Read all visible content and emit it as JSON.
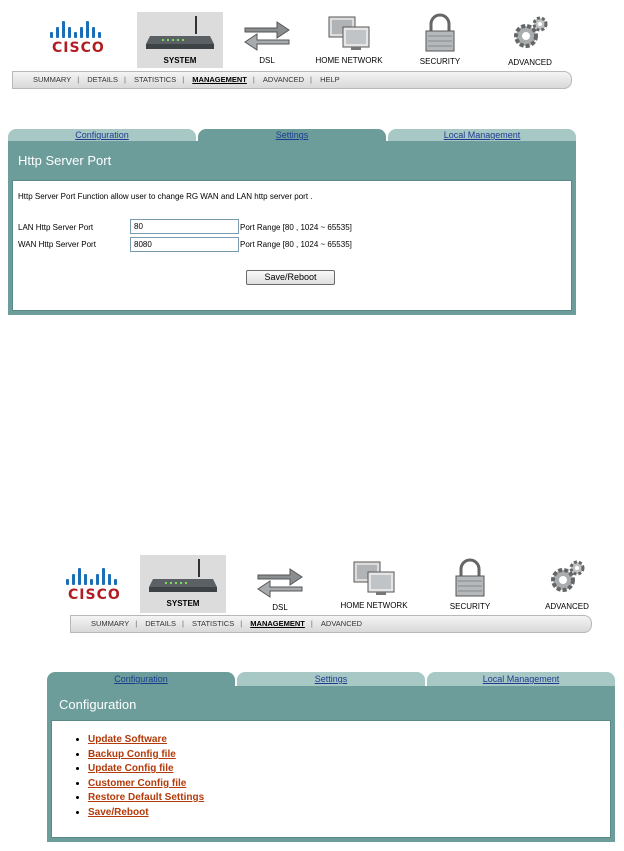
{
  "brand": {
    "logo_text": "CISCO"
  },
  "screen1": {
    "nav": [
      {
        "label": "SYSTEM",
        "icon": "router-icon",
        "active": true
      },
      {
        "label": "DSL",
        "icon": "arrows-icon"
      },
      {
        "label": "HOME NETWORK",
        "icon": "computers-icon"
      },
      {
        "label": "SECURITY",
        "icon": "padlock-icon"
      },
      {
        "label": "ADVANCED",
        "icon": "gears-icon"
      }
    ],
    "subnav": [
      "SUMMARY",
      "DETAILS",
      "STATISTICS",
      "MANAGEMENT",
      "ADVANCED",
      "HELP"
    ],
    "tabs": [
      "Configuration",
      "Settings",
      "Local Management"
    ],
    "title": "Http Server Port",
    "description": "Http Server Port Function allow user to change RG WAN and LAN http server port .",
    "lan_label": "LAN Http Server Port",
    "lan_value": "80",
    "wan_label": "WAN Http Server Port",
    "wan_value": "8080",
    "range_text": "Port Range [80 , 1024 ~ 65535]",
    "button": "Save/Reboot"
  },
  "screen2": {
    "nav": [
      {
        "label": "SYSTEM",
        "icon": "router-icon",
        "active": true
      },
      {
        "label": "DSL",
        "icon": "arrows-icon"
      },
      {
        "label": "HOME NETWORK",
        "icon": "computers-icon"
      },
      {
        "label": "SECURITY",
        "icon": "padlock-icon"
      },
      {
        "label": "ADVANCED",
        "icon": "gears-icon"
      }
    ],
    "subnav": [
      "SUMMARY",
      "DETAILS",
      "STATISTICS",
      "MANAGEMENT",
      "ADVANCED"
    ],
    "tabs": [
      "Configuration",
      "Settings",
      "Local Management"
    ],
    "title": "Configuration",
    "links": [
      "Update Software",
      "Backup Config file",
      "Update Config file",
      "Customer Config file",
      "Restore Default Settings",
      "Save/Reboot"
    ]
  }
}
